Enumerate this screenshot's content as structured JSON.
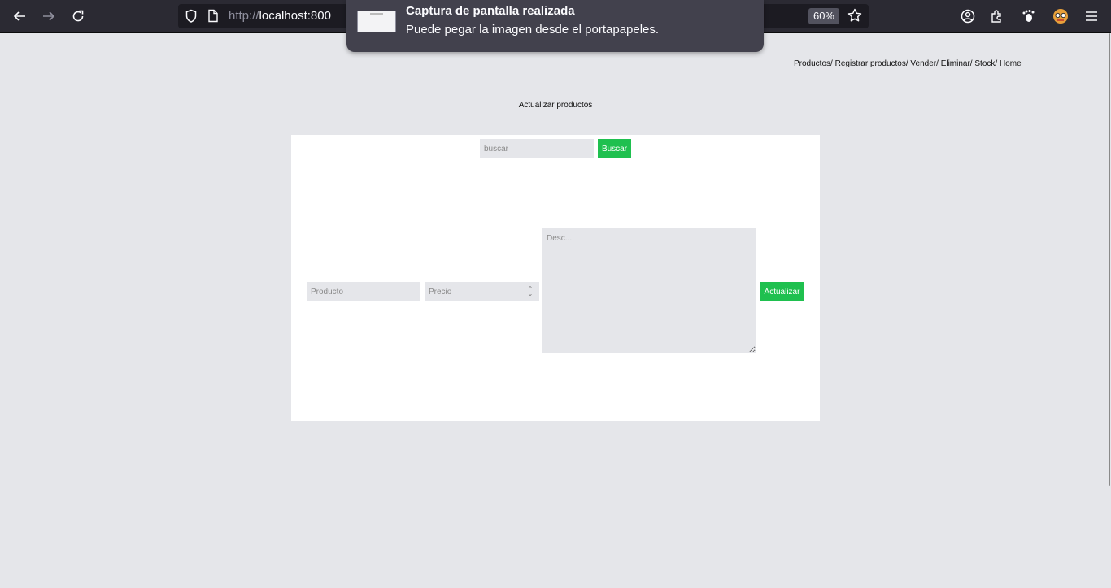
{
  "browser": {
    "url_prefix": "http://",
    "url_host": "localhost:800",
    "zoom": "60%"
  },
  "notification": {
    "title": "Captura de pantalla realizada",
    "message": "Puede pegar la imagen desde el portapapeles."
  },
  "nav": {
    "items": [
      "Productos/",
      "Registrar productos/",
      "Vender/",
      "Eliminar/",
      "Stock/",
      "Home"
    ]
  },
  "page": {
    "heading": "Actualizar productos"
  },
  "search": {
    "placeholder": "buscar",
    "button_label": "Buscar"
  },
  "form": {
    "product_placeholder": "Producto",
    "price_placeholder": "Precio",
    "desc_placeholder": "Desc...",
    "submit_label": "Actualizar"
  },
  "colors": {
    "accent": "#1fc04f",
    "page_bg": "#e5e6ea",
    "card_bg": "#ffffff"
  }
}
